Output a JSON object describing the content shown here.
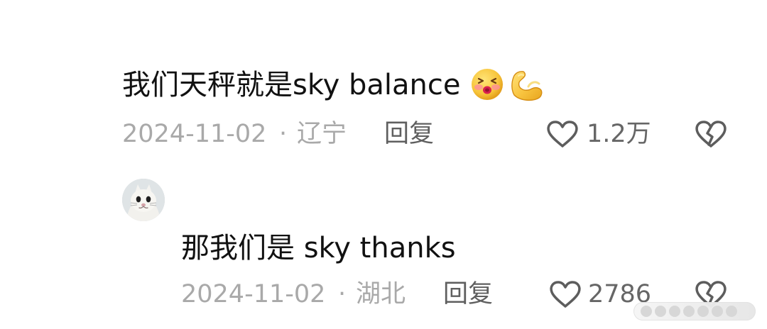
{
  "comment1": {
    "text": "我们天秤就是sky balance",
    "emoji_names": [
      "kiss-face-icon",
      "flexed-biceps-icon"
    ],
    "date": "2024-11-02",
    "location": "辽宁",
    "reply_label": "回复",
    "likes": "1.2万"
  },
  "comment2": {
    "avatar_name": "cat-avatar",
    "text": "那我们是 sky thanks",
    "date": "2024-11-02",
    "location": "湖北",
    "reply_label": "回复",
    "likes": "2786"
  },
  "separator": "·",
  "icons": {
    "like": "heart-icon",
    "dislike": "broken-heart-icon"
  }
}
